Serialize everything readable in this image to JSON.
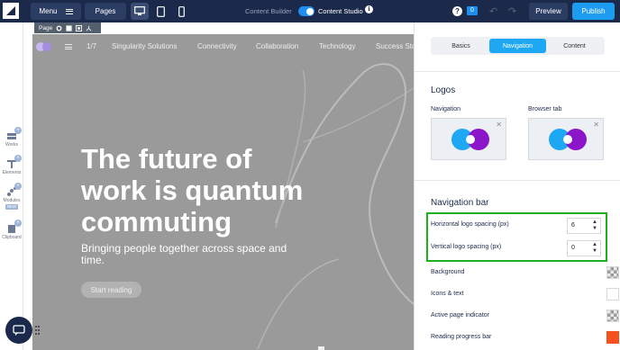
{
  "topbar": {
    "menu_label": "Menu",
    "pages_label": "Pages",
    "content_builder_label": "Content Builder",
    "content_studio_label": "Content Studio",
    "info_glyph": "i",
    "help_glyph": "?",
    "notification_count": "0",
    "preview_label": "Preview",
    "publish_label": "Publish",
    "toggle_on": true,
    "accent_color": "#1d9bf0",
    "bg_color": "#1b2a4a"
  },
  "left_rail": {
    "items": [
      {
        "label": "Works",
        "icon": "works-icon"
      },
      {
        "label": "Elements",
        "icon": "elements-icon"
      },
      {
        "label": "Modules",
        "icon": "modules-icon",
        "badge": "NEW"
      },
      {
        "label": "Clipboard",
        "icon": "clipboard-icon"
      }
    ]
  },
  "page_tag": {
    "label": "Page"
  },
  "canvas": {
    "page_counter": "1/7",
    "nav_links": [
      "Singularity Solutions",
      "Connectivity",
      "Collaboration",
      "Technology",
      "Success Sto"
    ],
    "hero_title": "The future of work is quantum commuting",
    "hero_subtitle": "Bringing people together across space and time.",
    "hero_button": "Start reading",
    "bg_color": "#9a9a9a"
  },
  "panel": {
    "tabs": [
      {
        "label": "Basics",
        "active": false
      },
      {
        "label": "Navigation",
        "active": true
      },
      {
        "label": "Content",
        "active": false
      }
    ],
    "logos_title": "Logos",
    "navigation_label": "Navigation",
    "browser_tab_label": "Browser tab",
    "nav_bar_title": "Navigation bar",
    "h_spacing_label": "Horizontal logo spacing (px)",
    "h_spacing_value": "6",
    "v_spacing_label": "Vertical logo spacing (px)",
    "v_spacing_value": "0",
    "background_label": "Background",
    "icons_text_label": "Icons & text",
    "active_indicator_label": "Active page indicator",
    "progress_bar_label": "Reading progress bar",
    "progress_bar_color": "#f4511e",
    "highlight_color": "#1db01d"
  }
}
